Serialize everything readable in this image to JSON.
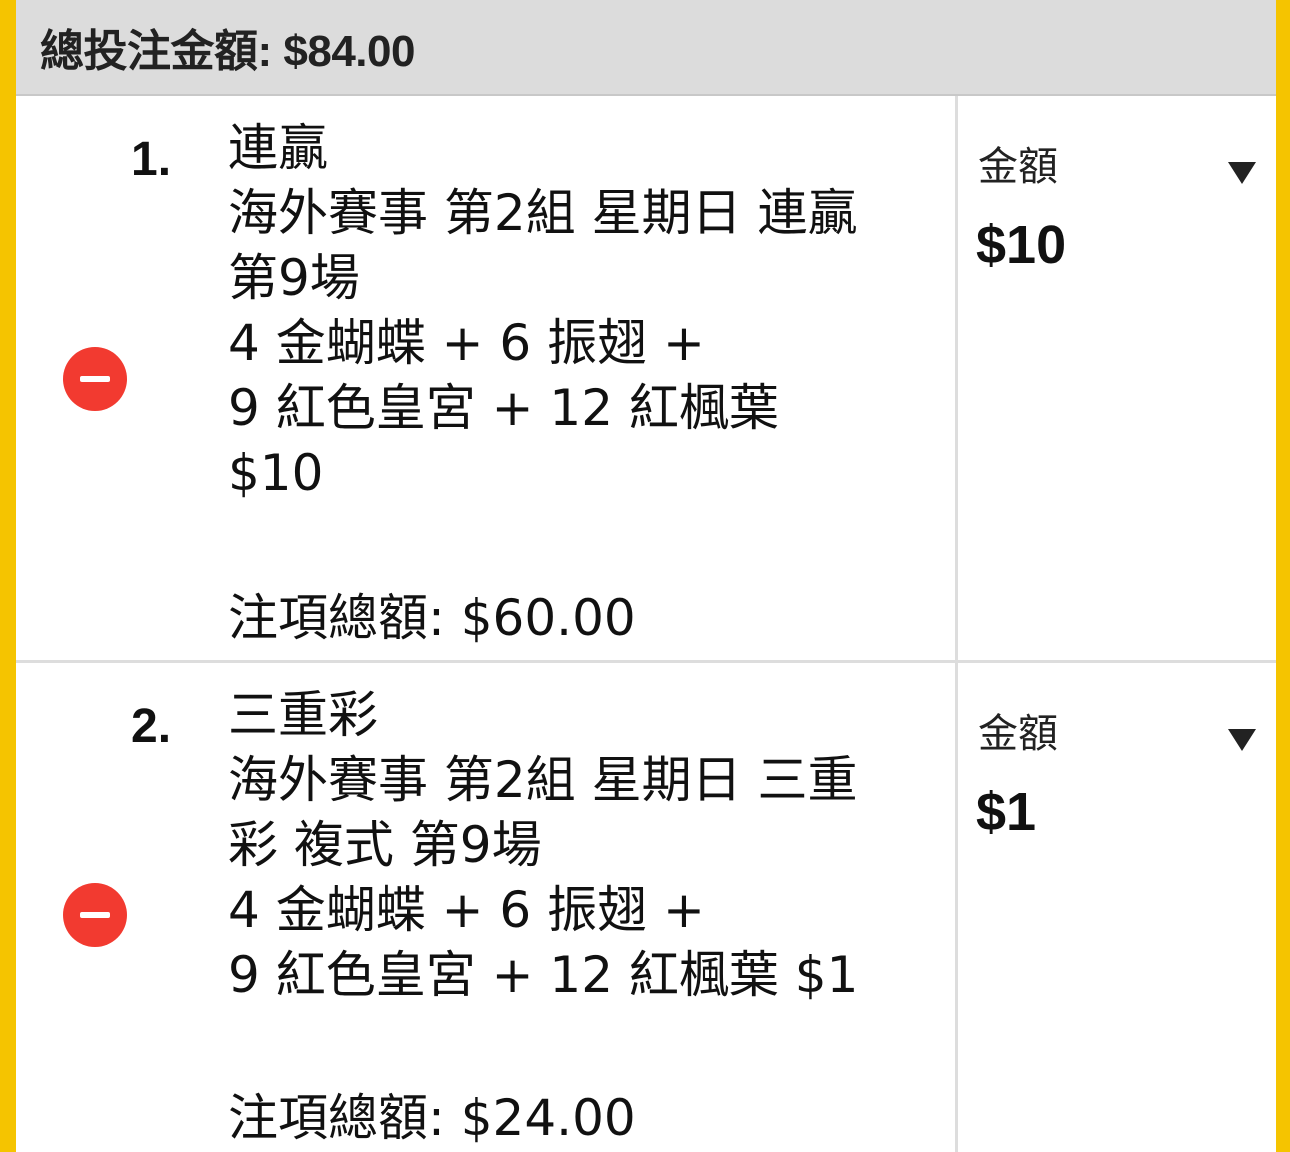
{
  "header": {
    "total_label": "總投注金額: $84.00"
  },
  "bets": [
    {
      "index": "1.",
      "type": "連贏",
      "description": "海外賽事 第2組 星期日 連贏",
      "race": "第9場",
      "selection_line1": "4 金蝴蝶 +  6 振翅 +",
      "selection_line2": "9 紅色皇宮 +  12 紅楓葉",
      "unit": "$10",
      "subtotal": "注項總額: $60.00",
      "amount_label": "金額",
      "amount_value": "$10"
    },
    {
      "index": "2.",
      "type": "三重彩",
      "description": "海外賽事 第2組 星期日 三重",
      "race": "彩 複式 第9場",
      "selection_line1": "4 金蝴蝶 +  6 振翅 +",
      "selection_line2": "9 紅色皇宮 +  12 紅楓葉 $1",
      "unit": "",
      "subtotal": "注項總額: $24.00",
      "amount_label": "金額",
      "amount_value": "$1"
    }
  ],
  "icons": {
    "remove": "minus-circle-icon",
    "dropdown": "triangle-down-icon"
  },
  "colors": {
    "accent_border": "#f5c400",
    "remove_button": "#f23a30",
    "header_bg": "#dcdcdc"
  }
}
